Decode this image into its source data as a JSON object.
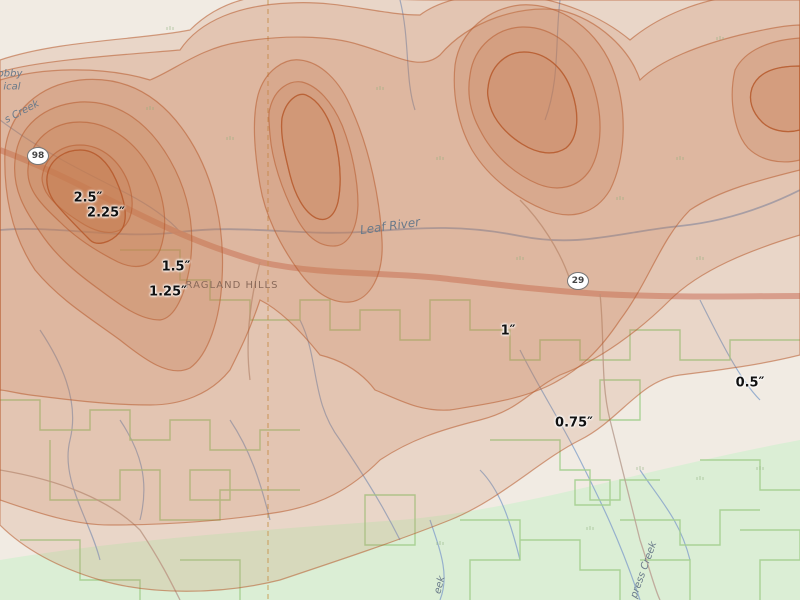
{
  "map": {
    "colors": {
      "base_land": "#f1ebe3",
      "forest": "#d8ecd2",
      "water_line": "#7a9ec8",
      "road_main": "#d99a86",
      "band_fill": "#c67a4e",
      "band_stroke": "#b65a2c",
      "parcel_outline": "#9fcf89"
    },
    "contour_labels": [
      {
        "id": "c-2-5",
        "text": "2.5″"
      },
      {
        "id": "c-2-25",
        "text": "2.25″"
      },
      {
        "id": "c-1-5",
        "text": "1.5″"
      },
      {
        "id": "c-1-25",
        "text": "1.25″"
      },
      {
        "id": "c-1",
        "text": "1″"
      },
      {
        "id": "c-0-75",
        "text": "0.75″"
      },
      {
        "id": "c-0-5",
        "text": "0.5″"
      }
    ],
    "place_labels": {
      "hills": "RAGLAND HILLS",
      "river": "Leaf River",
      "creek_nw": "s Creek",
      "creek_se": "press Creek",
      "creek_s": "eek",
      "edge_top": "obby",
      "edge_top2": "ical"
    },
    "route_shields": {
      "west": "98",
      "east": "29"
    }
  }
}
